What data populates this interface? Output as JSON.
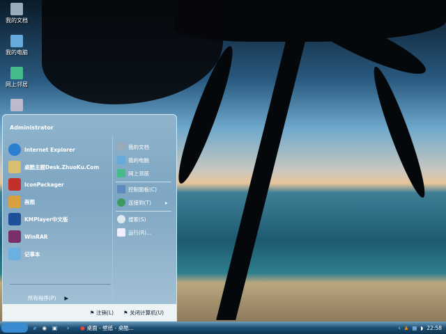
{
  "desktop": {
    "icons": [
      {
        "label": "我的文档"
      },
      {
        "label": "我的电脑"
      },
      {
        "label": "网上邻居"
      },
      {
        "label": ""
      }
    ]
  },
  "start_menu": {
    "user": "Administrator",
    "left_items": [
      {
        "label": "Internet Explorer",
        "icon": "ie-icon"
      },
      {
        "label": "桌酷主题Desk.ZhuoKu.Com",
        "icon": "theme-icon"
      },
      {
        "label": "IconPackager",
        "icon": "iconpackager-icon"
      },
      {
        "label": "画图",
        "icon": "paint-icon"
      },
      {
        "label": "KMPlayer中文版",
        "icon": "kmplayer-icon"
      },
      {
        "label": "WinRAR",
        "icon": "winrar-icon"
      },
      {
        "label": "记事本",
        "icon": "notepad-icon"
      }
    ],
    "all_programs": "所有程序(P)",
    "right_items": [
      {
        "label": "我的文档"
      },
      {
        "label": "我的电脑"
      },
      {
        "label": "网上邻居"
      },
      {
        "label": "控制面板(C)"
      },
      {
        "label": "连接到(T)"
      },
      {
        "label": "搜索(S)"
      },
      {
        "label": "运行(R)..."
      }
    ],
    "logoff": "注销(L)",
    "shutdown": "关闭计算机(U)"
  },
  "taskbar": {
    "task": "桌面 - 壁纸 - 桌酷...",
    "clock": "22:58"
  }
}
